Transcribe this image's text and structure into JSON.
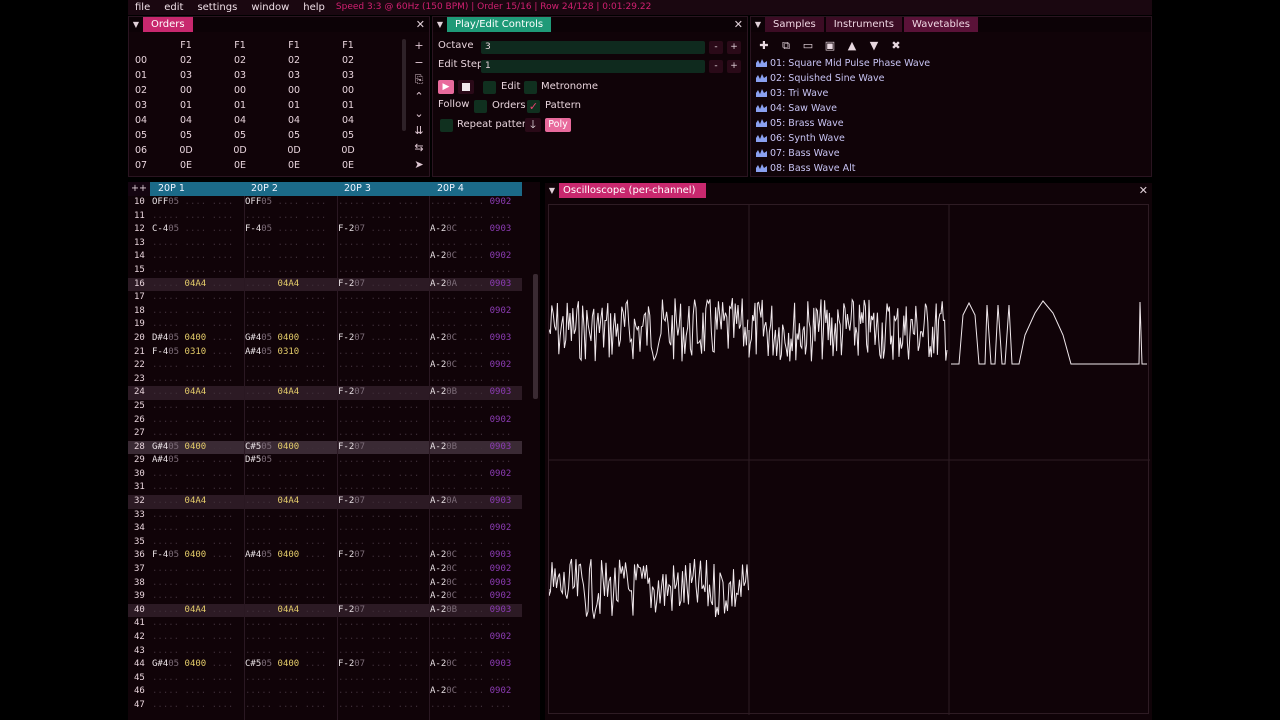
{
  "menu": {
    "items": [
      "file",
      "edit",
      "settings",
      "window",
      "help"
    ],
    "status": "Speed 3:3 @ 60Hz (150 BPM) | Order 15/16 | Row 24/128 | 0:01:29.22"
  },
  "orders": {
    "title": "Orders",
    "columns": [
      "F1",
      "F1",
      "F1",
      "F1"
    ],
    "rows": [
      {
        "idx": "00",
        "vals": [
          "02",
          "02",
          "02",
          "02"
        ]
      },
      {
        "idx": "01",
        "vals": [
          "03",
          "03",
          "03",
          "03"
        ]
      },
      {
        "idx": "02",
        "vals": [
          "00",
          "00",
          "00",
          "00"
        ]
      },
      {
        "idx": "03",
        "vals": [
          "01",
          "01",
          "01",
          "01"
        ]
      },
      {
        "idx": "04",
        "vals": [
          "04",
          "04",
          "04",
          "04"
        ]
      },
      {
        "idx": "05",
        "vals": [
          "05",
          "05",
          "05",
          "05"
        ]
      },
      {
        "idx": "06",
        "vals": [
          "0D",
          "0D",
          "0D",
          "0D"
        ]
      },
      {
        "idx": "07",
        "vals": [
          "0E",
          "0E",
          "0E",
          "0E"
        ]
      }
    ],
    "side_icons": [
      "plus-icon",
      "minus-icon",
      "duplicate-icon",
      "move-up-icon",
      "move-down-icon",
      "deep-clone-icon",
      "swap-icon",
      "cursor-icon"
    ]
  },
  "play_edit": {
    "title": "Play/Edit Controls",
    "octave_label": "Octave",
    "octave_value": "3",
    "edit_step_label": "Edit Step",
    "edit_step_value": "1",
    "minus": "-",
    "plus": "+",
    "edit_label": "Edit",
    "metronome_label": "Metronome",
    "follow_label": "Follow",
    "orders_label": "Orders",
    "pattern_label": "Pattern",
    "repeat_label": "Repeat pattern",
    "poly_label": "Poly"
  },
  "samples": {
    "tabs": [
      "Samples",
      "Instruments",
      "Wavetables"
    ],
    "items": [
      "01: Square Mid Pulse Phase Wave",
      "02: Squished Sine Wave",
      "03: Tri Wave",
      "04: Saw Wave",
      "05: Brass Wave",
      "06: Synth Wave",
      "07: Bass Wave",
      "08: Bass Wave Alt"
    ],
    "icon_color": "#8aa0f0"
  },
  "pattern": {
    "add_label": "++",
    "channels": [
      "20P 1",
      "20P 2",
      "20P 3",
      "20P 4"
    ],
    "rows": [
      {
        "r": "10",
        "c": [
          [
            "OFF",
            "05",
            "",
            ""
          ],
          [
            "OFF",
            "05",
            "",
            ""
          ],
          [
            "",
            "",
            "",
            ""
          ],
          [
            "",
            "",
            "",
            "0902"
          ]
        ]
      },
      {
        "r": "11",
        "c": [
          [
            "",
            "",
            "",
            ""
          ],
          [
            "",
            "",
            "",
            ""
          ],
          [
            "",
            "",
            "",
            ""
          ],
          [
            "",
            "",
            "",
            ""
          ]
        ]
      },
      {
        "r": "12",
        "c": [
          [
            "C-4",
            "05",
            "",
            ""
          ],
          [
            "F-4",
            "05",
            "",
            ""
          ],
          [
            "F-2",
            "07",
            "",
            ""
          ],
          [
            "A-2",
            "0C",
            "",
            "0903"
          ]
        ]
      },
      {
        "r": "13",
        "c": [
          [
            "",
            "",
            "",
            ""
          ],
          [
            "",
            "",
            "",
            ""
          ],
          [
            "",
            "",
            "",
            ""
          ],
          [
            "",
            "",
            "",
            ""
          ]
        ]
      },
      {
        "r": "14",
        "c": [
          [
            "",
            "",
            "",
            ""
          ],
          [
            "",
            "",
            "",
            ""
          ],
          [
            "",
            "",
            "",
            ""
          ],
          [
            "A-2",
            "0C",
            "",
            "0902"
          ]
        ]
      },
      {
        "r": "15",
        "c": [
          [
            "",
            "",
            "",
            ""
          ],
          [
            "",
            "",
            "",
            ""
          ],
          [
            "",
            "",
            "",
            ""
          ],
          [
            "",
            "",
            "",
            ""
          ]
        ]
      },
      {
        "r": "16",
        "c": [
          [
            "",
            "",
            "04A4",
            ""
          ],
          [
            "",
            "",
            "04A4",
            ""
          ],
          [
            "F-2",
            "07",
            "",
            ""
          ],
          [
            "A-2",
            "0A",
            "",
            "0903"
          ]
        ],
        "hl": 1
      },
      {
        "r": "17",
        "c": [
          [
            "",
            "",
            "",
            ""
          ],
          [
            "",
            "",
            "",
            ""
          ],
          [
            "",
            "",
            "",
            ""
          ],
          [
            "",
            "",
            "",
            ""
          ]
        ]
      },
      {
        "r": "18",
        "c": [
          [
            "",
            "",
            "",
            ""
          ],
          [
            "",
            "",
            "",
            ""
          ],
          [
            "",
            "",
            "",
            ""
          ],
          [
            "",
            "",
            "",
            "0902"
          ]
        ]
      },
      {
        "r": "19",
        "c": [
          [
            "",
            "",
            "",
            ""
          ],
          [
            "",
            "",
            "",
            ""
          ],
          [
            "",
            "",
            "",
            ""
          ],
          [
            "",
            "",
            "",
            ""
          ]
        ]
      },
      {
        "r": "20",
        "c": [
          [
            "D#4",
            "05",
            "0400",
            ""
          ],
          [
            "G#4",
            "05",
            "0400",
            ""
          ],
          [
            "F-2",
            "07",
            "",
            ""
          ],
          [
            "A-2",
            "0C",
            "",
            "0903"
          ]
        ]
      },
      {
        "r": "21",
        "c": [
          [
            "F-4",
            "05",
            "0310",
            ""
          ],
          [
            "A#4",
            "05",
            "0310",
            ""
          ],
          [
            "",
            "",
            "",
            ""
          ],
          [
            "",
            "",
            "",
            ""
          ]
        ]
      },
      {
        "r": "22",
        "c": [
          [
            "",
            "",
            "",
            ""
          ],
          [
            "",
            "",
            "",
            ""
          ],
          [
            "",
            "",
            "",
            ""
          ],
          [
            "A-2",
            "0C",
            "",
            "0902"
          ]
        ]
      },
      {
        "r": "23",
        "c": [
          [
            "",
            "",
            "",
            ""
          ],
          [
            "",
            "",
            "",
            ""
          ],
          [
            "",
            "",
            "",
            ""
          ],
          [
            "",
            "",
            "",
            ""
          ]
        ]
      },
      {
        "r": "24",
        "c": [
          [
            "",
            "",
            "04A4",
            ""
          ],
          [
            "",
            "",
            "04A4",
            ""
          ],
          [
            "F-2",
            "07",
            "",
            ""
          ],
          [
            "A-2",
            "0B",
            "",
            "0903"
          ]
        ],
        "hl": 1
      },
      {
        "r": "25",
        "c": [
          [
            "",
            "",
            "",
            ""
          ],
          [
            "",
            "",
            "",
            ""
          ],
          [
            "",
            "",
            "",
            ""
          ],
          [
            "",
            "",
            "",
            ""
          ]
        ]
      },
      {
        "r": "26",
        "c": [
          [
            "",
            "",
            "",
            ""
          ],
          [
            "",
            "",
            "",
            ""
          ],
          [
            "",
            "",
            "",
            ""
          ],
          [
            "",
            "",
            "",
            "0902"
          ]
        ]
      },
      {
        "r": "27",
        "c": [
          [
            "",
            "",
            "",
            ""
          ],
          [
            "",
            "",
            "",
            ""
          ],
          [
            "",
            "",
            "",
            ""
          ],
          [
            "",
            "",
            "",
            ""
          ]
        ]
      },
      {
        "r": "28",
        "c": [
          [
            "G#4",
            "05",
            "0400",
            ""
          ],
          [
            "C#5",
            "05",
            "0400",
            ""
          ],
          [
            "F-2",
            "07",
            "",
            ""
          ],
          [
            "A-2",
            "0B",
            "",
            "0903"
          ]
        ],
        "hl": 2
      },
      {
        "r": "29",
        "c": [
          [
            "A#4",
            "05",
            "",
            ""
          ],
          [
            "D#5",
            "05",
            "",
            ""
          ],
          [
            "",
            "",
            "",
            ""
          ],
          [
            "",
            "",
            "",
            ""
          ]
        ]
      },
      {
        "r": "30",
        "c": [
          [
            "",
            "",
            "",
            ""
          ],
          [
            "",
            "",
            "",
            ""
          ],
          [
            "",
            "",
            "",
            ""
          ],
          [
            "",
            "",
            "",
            "0902"
          ]
        ]
      },
      {
        "r": "31",
        "c": [
          [
            "",
            "",
            "",
            ""
          ],
          [
            "",
            "",
            "",
            ""
          ],
          [
            "",
            "",
            "",
            ""
          ],
          [
            "",
            "",
            "",
            ""
          ]
        ]
      },
      {
        "r": "32",
        "c": [
          [
            "",
            "",
            "04A4",
            ""
          ],
          [
            "",
            "",
            "04A4",
            ""
          ],
          [
            "F-2",
            "07",
            "",
            ""
          ],
          [
            "A-2",
            "0A",
            "",
            "0903"
          ]
        ],
        "hl": 1
      },
      {
        "r": "33",
        "c": [
          [
            "",
            "",
            "",
            ""
          ],
          [
            "",
            "",
            "",
            ""
          ],
          [
            "",
            "",
            "",
            ""
          ],
          [
            "",
            "",
            "",
            ""
          ]
        ]
      },
      {
        "r": "34",
        "c": [
          [
            "",
            "",
            "",
            ""
          ],
          [
            "",
            "",
            "",
            ""
          ],
          [
            "",
            "",
            "",
            ""
          ],
          [
            "",
            "",
            "",
            "0902"
          ]
        ]
      },
      {
        "r": "35",
        "c": [
          [
            "",
            "",
            "",
            ""
          ],
          [
            "",
            "",
            "",
            ""
          ],
          [
            "",
            "",
            "",
            ""
          ],
          [
            "",
            "",
            "",
            ""
          ]
        ]
      },
      {
        "r": "36",
        "c": [
          [
            "F-4",
            "05",
            "0400",
            ""
          ],
          [
            "A#4",
            "05",
            "0400",
            ""
          ],
          [
            "F-2",
            "07",
            "",
            ""
          ],
          [
            "A-2",
            "0C",
            "",
            "0903"
          ]
        ]
      },
      {
        "r": "37",
        "c": [
          [
            "",
            "",
            "",
            ""
          ],
          [
            "",
            "",
            "",
            ""
          ],
          [
            "",
            "",
            "",
            ""
          ],
          [
            "A-2",
            "0C",
            "",
            "0902"
          ]
        ]
      },
      {
        "r": "38",
        "c": [
          [
            "",
            "",
            "",
            ""
          ],
          [
            "",
            "",
            "",
            ""
          ],
          [
            "",
            "",
            "",
            ""
          ],
          [
            "A-2",
            "0C",
            "",
            "0903"
          ]
        ]
      },
      {
        "r": "39",
        "c": [
          [
            "",
            "",
            "",
            ""
          ],
          [
            "",
            "",
            "",
            ""
          ],
          [
            "",
            "",
            "",
            ""
          ],
          [
            "A-2",
            "0C",
            "",
            "0902"
          ]
        ]
      },
      {
        "r": "40",
        "c": [
          [
            "",
            "",
            "04A4",
            ""
          ],
          [
            "",
            "",
            "04A4",
            ""
          ],
          [
            "F-2",
            "07",
            "",
            ""
          ],
          [
            "A-2",
            "0B",
            "",
            "0903"
          ]
        ],
        "hl": 1
      },
      {
        "r": "41",
        "c": [
          [
            "",
            "",
            "",
            ""
          ],
          [
            "",
            "",
            "",
            ""
          ],
          [
            "",
            "",
            "",
            ""
          ],
          [
            "",
            "",
            "",
            ""
          ]
        ]
      },
      {
        "r": "42",
        "c": [
          [
            "",
            "",
            "",
            ""
          ],
          [
            "",
            "",
            "",
            ""
          ],
          [
            "",
            "",
            "",
            ""
          ],
          [
            "",
            "",
            "",
            "0902"
          ]
        ]
      },
      {
        "r": "43",
        "c": [
          [
            "",
            "",
            "",
            ""
          ],
          [
            "",
            "",
            "",
            ""
          ],
          [
            "",
            "",
            "",
            ""
          ],
          [
            "",
            "",
            "",
            ""
          ]
        ]
      },
      {
        "r": "44",
        "c": [
          [
            "G#4",
            "05",
            "0400",
            ""
          ],
          [
            "C#5",
            "05",
            "0400",
            ""
          ],
          [
            "F-2",
            "07",
            "",
            ""
          ],
          [
            "A-2",
            "0C",
            "",
            "0903"
          ]
        ]
      },
      {
        "r": "45",
        "c": [
          [
            "",
            "",
            "",
            ""
          ],
          [
            "",
            "",
            "",
            ""
          ],
          [
            "",
            "",
            "",
            ""
          ],
          [
            "",
            "",
            "",
            ""
          ]
        ]
      },
      {
        "r": "46",
        "c": [
          [
            "",
            "",
            "",
            ""
          ],
          [
            "",
            "",
            "",
            ""
          ],
          [
            "",
            "",
            "",
            ""
          ],
          [
            "A-2",
            "0C",
            "",
            "0902"
          ]
        ]
      },
      {
        "r": "47",
        "c": [
          [
            "",
            "",
            "",
            ""
          ],
          [
            "",
            "",
            "",
            ""
          ],
          [
            "",
            "",
            "",
            ""
          ],
          [
            "",
            "",
            "",
            ""
          ]
        ]
      }
    ]
  },
  "oscilloscope": {
    "title": "Oscilloscope (per-channel)"
  },
  "colors": {
    "accent": "#c8286e",
    "note": "#e8e0e4",
    "effect": "#e4cc6a",
    "volume": "#8c3cb4",
    "channel_header": "#1b6a88"
  }
}
